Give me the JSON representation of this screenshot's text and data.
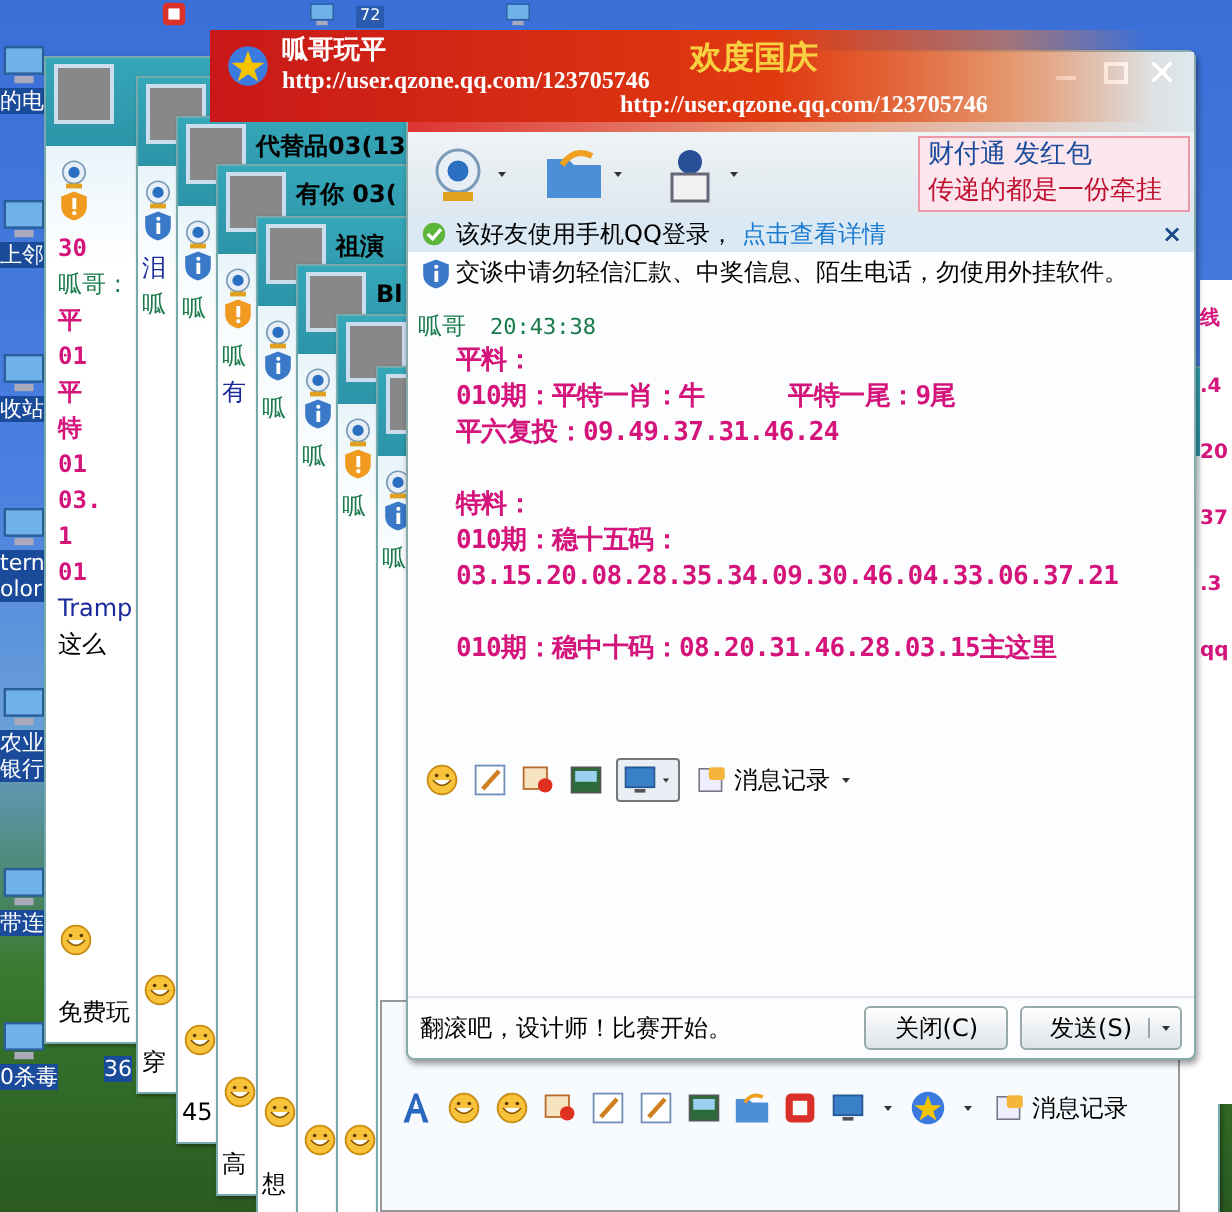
{
  "desktop_icons": [
    {
      "lines": [
        "的电"
      ]
    },
    {
      "lines": [
        "上邻"
      ]
    },
    {
      "lines": [
        "收站"
      ]
    },
    {
      "lines": [
        "tern",
        "olor"
      ]
    },
    {
      "lines": [
        "农业",
        "银行"
      ]
    },
    {
      "lines": [
        "带连"
      ]
    },
    {
      "lines": [
        "0杀毒"
      ]
    }
  ],
  "desktop_badge": "72",
  "desktop_label_extra": "36",
  "back_windows": [
    {
      "top_lines": [
        {
          "text": "30",
          "kind": "content"
        },
        {
          "text": "呱哥 :",
          "kind": "sender"
        },
        {
          "text": "平",
          "kind": "content"
        },
        {
          "text": "01",
          "kind": "content"
        },
        {
          "text": "平",
          "kind": "content"
        },
        {
          "text": "特",
          "kind": "content"
        },
        {
          "text": "01",
          "kind": "content"
        },
        {
          "text": "03.",
          "kind": "content"
        },
        {
          "text": "1",
          "kind": "content"
        },
        {
          "text": "01",
          "kind": "content"
        },
        {
          "text": "Tramp",
          "kind": "name"
        },
        {
          "text": "这么",
          "kind": "plain"
        }
      ],
      "bottom_lines": [
        {
          "text": "免费玩",
          "kind": "plain"
        }
      ]
    },
    {
      "top_lines": [
        {
          "text": "泪",
          "kind": "name"
        },
        {
          "text": "呱",
          "kind": "sender"
        }
      ],
      "bottom_lines": [
        {
          "text": "穿",
          "kind": "plain"
        }
      ]
    },
    {
      "title": "代替品03(13",
      "top_lines": [
        {
          "text": "呱",
          "kind": "sender"
        }
      ],
      "bottom_lines": [
        {
          "text": "45",
          "kind": "plain"
        }
      ]
    },
    {
      "title": "有你 03(",
      "top_lines": [
        {
          "text": "呱",
          "kind": "sender"
        },
        {
          "text": "有",
          "kind": "name"
        }
      ],
      "bottom_lines": [
        {
          "text": "高",
          "kind": "plain"
        }
      ]
    },
    {
      "title": "祖演",
      "top_lines": [
        {
          "text": "呱",
          "kind": "sender"
        }
      ],
      "bottom_lines": [
        {
          "text": "想",
          "kind": "plain"
        }
      ]
    },
    {
      "title": "Bl",
      "top_lines": [
        {
          "text": "呱",
          "kind": "sender"
        }
      ]
    },
    {
      "top_lines": [
        {
          "text": "呱",
          "kind": "sender"
        }
      ]
    },
    {
      "top_lines": [
        {
          "text": "呱",
          "kind": "sender"
        }
      ]
    }
  ],
  "right_window": {
    "lines": [
      "线",
      ".4",
      "20",
      "37",
      ".3",
      "qq"
    ]
  },
  "banner": {
    "title": "呱哥玩平",
    "url": "http://user.qzone.qq.com/123705746",
    "slogan": "欢度国庆",
    "url_repeat": "http://user.qzone.qq.com/123705746"
  },
  "chat_window": {
    "ad": [
      "财付通 发红包",
      "传递的都是一份牵挂"
    ],
    "notice": {
      "text": "该好友使用手机QQ登录，",
      "link": "点击查看详情",
      "close": "×"
    },
    "warning": "交谈中请勿轻信汇款、中奖信息、陌生电话，勿使用外挂软件。",
    "message": {
      "sender": "呱哥",
      "time": "20:43:38",
      "blocks": [
        [
          [
            "平料："
          ],
          [
            "010期：平特一肖：牛",
            "平特一尾：9尾"
          ],
          [
            "平六复投：09.49.37.31.46.24"
          ]
        ],
        [
          [
            "特料："
          ],
          [
            "010期：稳十五码："
          ],
          [
            "03.15.20.08.28.35.34.09.30.46.04.33.06.37.21"
          ]
        ],
        [
          [
            "010期：稳中十码：08.20.31.46.28.03.15主这里"
          ]
        ]
      ]
    },
    "toolbar_history": "消息记录",
    "status_text": "翻滚吧，设计师！比赛开始。",
    "buttons": [
      "关闭(C)",
      "发送(S)"
    ]
  },
  "bottom_window": {
    "toolbar_history": "消息记录"
  }
}
